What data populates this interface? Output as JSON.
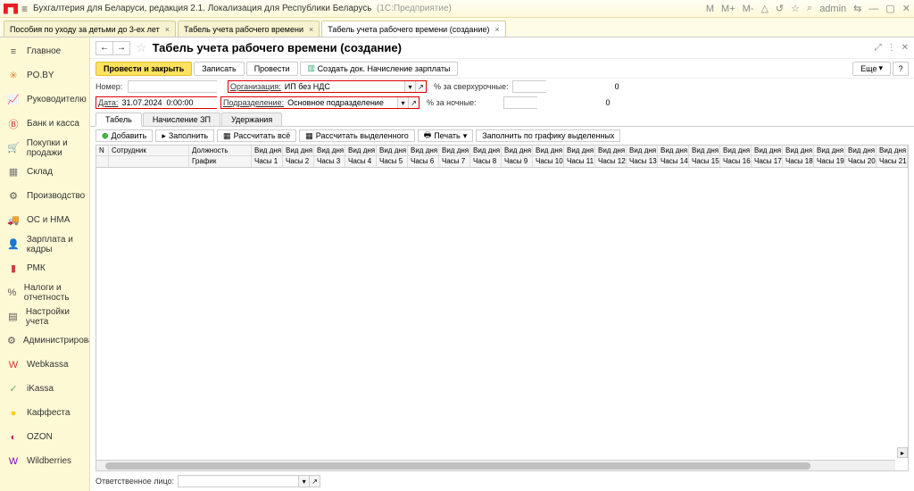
{
  "title": {
    "text": "Бухгалтерия для Беларуси, редакция 2.1. Локализация для Республики Беларусь",
    "suffix": "(1С:Предприятие)",
    "user": "admin"
  },
  "top_m": {
    "m1": "M",
    "m2": "M+",
    "m3": "M-"
  },
  "tabs": [
    {
      "label": "Пособия по уходу за детьми до 3-ех лет"
    },
    {
      "label": "Табель учета рабочего времени"
    },
    {
      "label": "Табель учета рабочего времени (создание)",
      "active": true
    }
  ],
  "sidebar": [
    {
      "label": "Главное",
      "color": "#555",
      "glyph": "≡"
    },
    {
      "label": "PO.BY",
      "color": "#e08030",
      "glyph": "✳"
    },
    {
      "label": "Руководителю",
      "color": "#7a4",
      "glyph": "📈"
    },
    {
      "label": "Банк и касса",
      "color": "#c33",
      "glyph": "Ⓑ"
    },
    {
      "label": "Покупки и продажи",
      "color": "#444",
      "glyph": "🛒"
    },
    {
      "label": "Склад",
      "color": "#777",
      "glyph": "▦"
    },
    {
      "label": "Производство",
      "color": "#555",
      "glyph": "⚙"
    },
    {
      "label": "ОС и НМА",
      "color": "#555",
      "glyph": "🚚"
    },
    {
      "label": "Зарплата и кадры",
      "color": "#555",
      "glyph": "👤"
    },
    {
      "label": "РМК",
      "color": "#c44",
      "glyph": "▮"
    },
    {
      "label": "Налоги и отчетность",
      "color": "#555",
      "glyph": "%"
    },
    {
      "label": "Настройки учета",
      "color": "#555",
      "glyph": "▤"
    },
    {
      "label": "Администрирование",
      "color": "#555",
      "glyph": "⚙"
    },
    {
      "label": "Webkassa",
      "color": "#d33",
      "glyph": "W"
    },
    {
      "label": "iKassa",
      "color": "#6a6",
      "glyph": "✓"
    },
    {
      "label": "Каффеста",
      "color": "#fc0",
      "glyph": "●"
    },
    {
      "label": "OZON",
      "color": "#c02060",
      "glyph": "◐"
    },
    {
      "label": "Wildberries",
      "color": "#80c",
      "glyph": "W"
    }
  ],
  "page": {
    "title": "Табель учета рабочего времени (создание)"
  },
  "cmds": {
    "c1": "Провести и закрыть",
    "c2": "Записать",
    "c3": "Провести",
    "c4": "Создать док. Начисление зарплаты",
    "more": "Еще"
  },
  "form": {
    "numLabel": "Номер:",
    "numVal": "",
    "orgLabel": "Организация:",
    "orgVal": "ИП без НДС",
    "dateLabel": "Дата:",
    "dateVal": "31.07.2024  0:00:00",
    "subdLabel": "Подразделение:",
    "subdVal": "Основное подразделение",
    "overLabel": "% за сверхурочные:",
    "overVal": "0",
    "nightLabel": "% за ночные:",
    "nightVal": "0"
  },
  "doctabs": [
    {
      "l": "Табель",
      "a": true
    },
    {
      "l": "Начисление ЗП"
    },
    {
      "l": "Удержания"
    }
  ],
  "tb2": {
    "add": "Добавить",
    "fill": "Заполнить",
    "recalc": "Рассчитать всё",
    "recalcSel": "Рассчитать выделенного",
    "print": "Печать",
    "fillSched": "Заполнить по графику выделенных"
  },
  "grid": {
    "fixed": [
      {
        "top": "N",
        "bot": "",
        "w": 14
      },
      {
        "top": "Сотрудник",
        "bot": "",
        "w": 90
      },
      {
        "top": "Должность",
        "bot": "График",
        "w": 70
      }
    ],
    "days": 21
  },
  "footer": {
    "label": "Ответственное лицо:"
  }
}
